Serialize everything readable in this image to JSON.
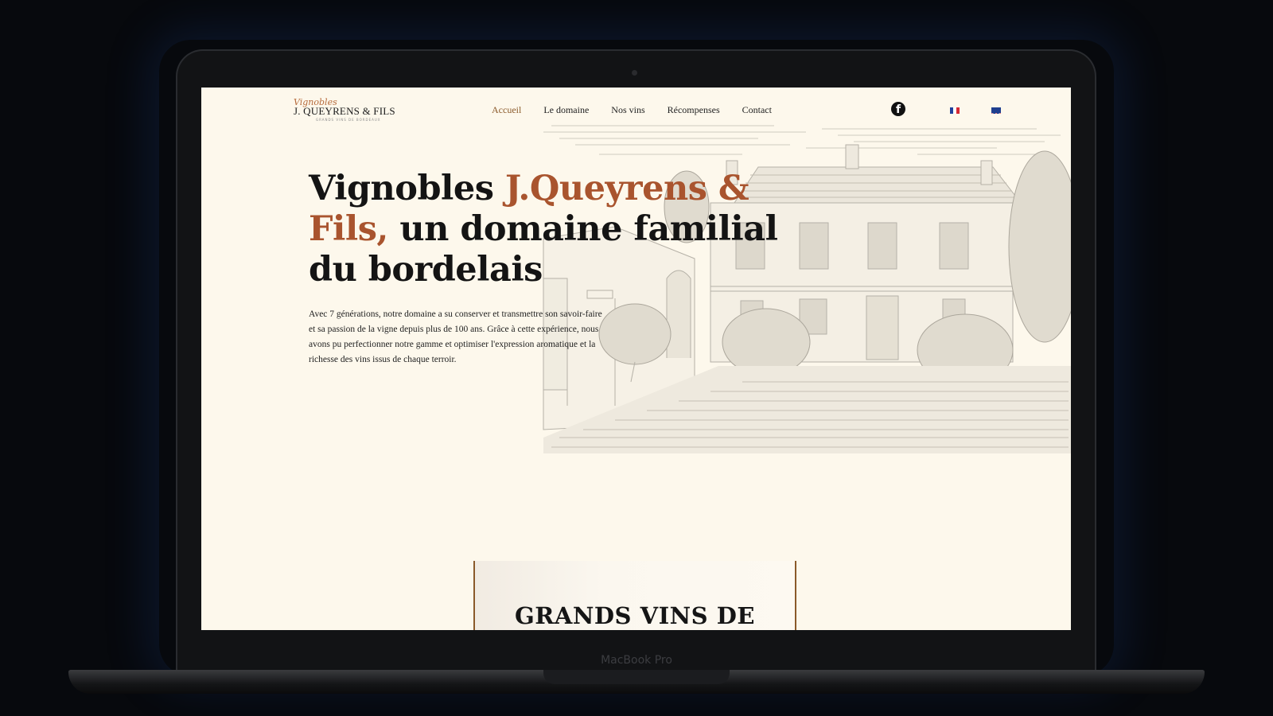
{
  "device": {
    "brand": "MacBook Pro"
  },
  "header": {
    "logo": {
      "script": "Vignobles",
      "main": "J. QUEYRENS & FILS",
      "sub": "GRANDS VINS DE BORDEAUX"
    },
    "nav": [
      {
        "label": "Accueil",
        "active": true
      },
      {
        "label": "Le domaine",
        "active": false
      },
      {
        "label": "Nos vins",
        "active": false
      },
      {
        "label": "Récompenses",
        "active": false
      },
      {
        "label": "Contact",
        "active": false
      }
    ],
    "social_icon": "facebook-icon",
    "languages": [
      {
        "code": "fr",
        "icon": "flag-fr-icon"
      },
      {
        "code": "en",
        "icon": "flag-gb-icon"
      }
    ]
  },
  "hero": {
    "title_part1": "Vignobles ",
    "title_accent": "J.Queyrens & Fils,",
    "title_part2": " un domaine familial du bordelais",
    "text": "Avec 7 générations, notre domaine a su conserver et transmettre son savoir-faire et sa passion de la vigne depuis plus de 100 ans. Grâce à cette expérience, nous avons pu perfectionner notre gamme et optimiser l'expression aromatique et la richesse des vins issus de chaque terroir."
  },
  "section": {
    "title": "GRANDS VINS DE"
  },
  "colors": {
    "background": "#fdf8ec",
    "accent": "#a9542e",
    "nav_active": "#8b5a2b",
    "card_border": "#8a5a2a"
  }
}
